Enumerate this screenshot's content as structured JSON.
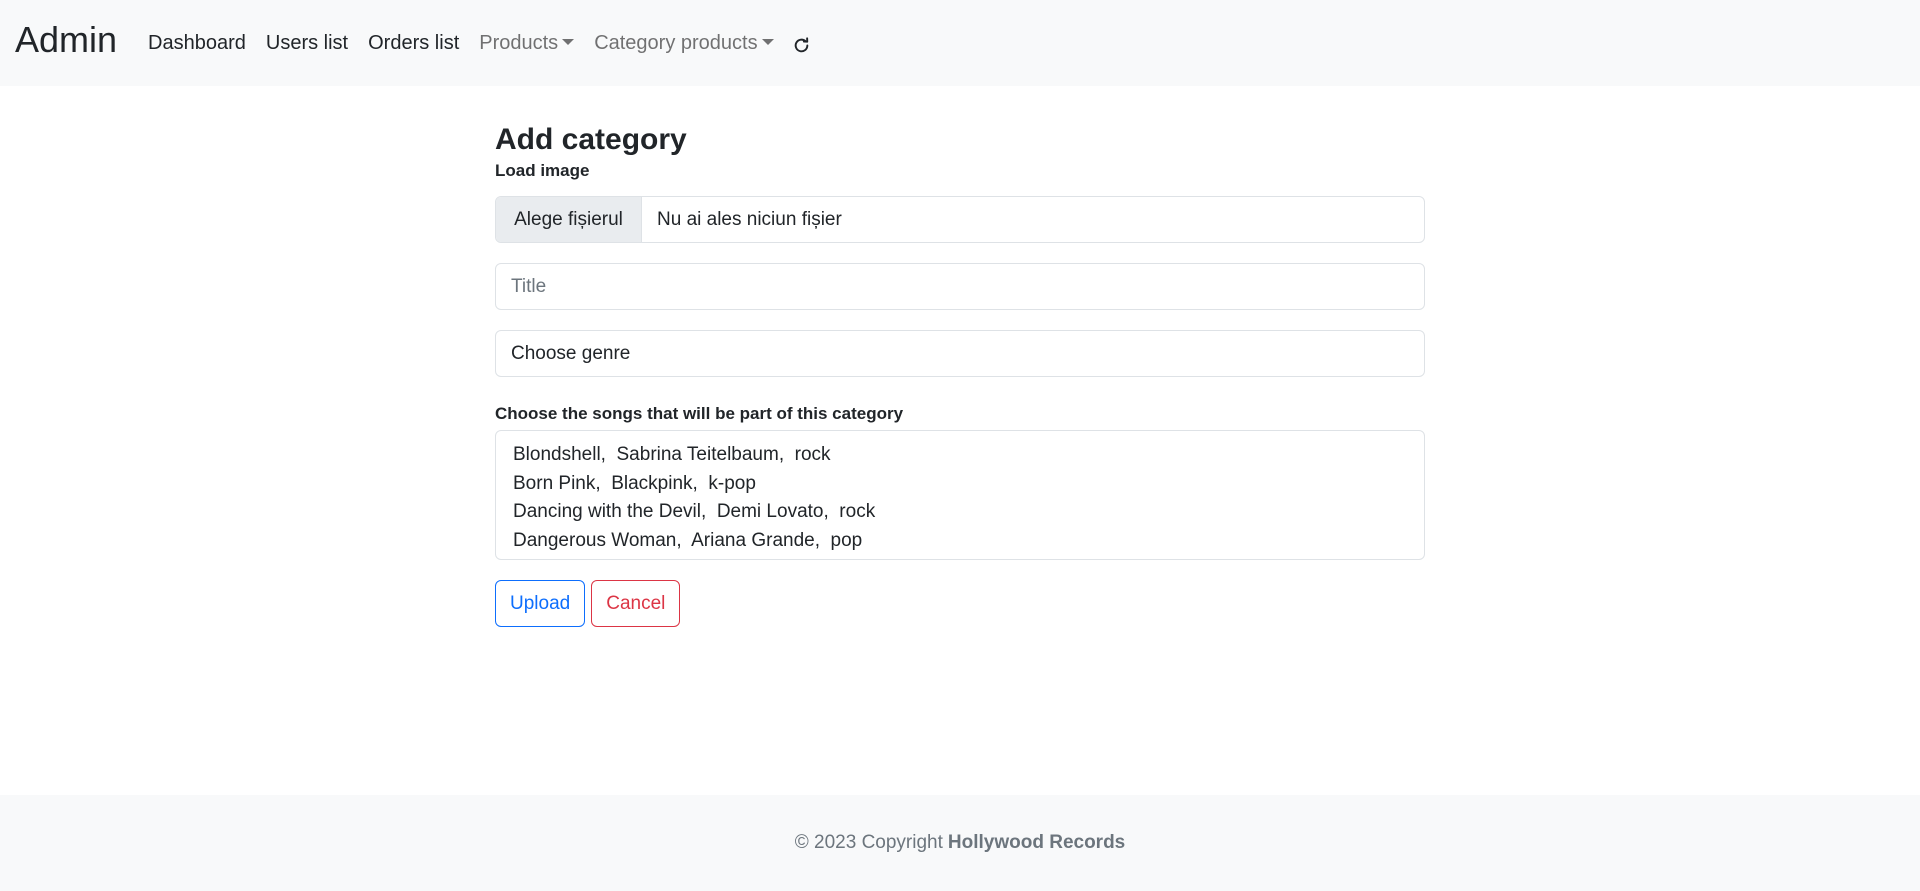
{
  "navbar": {
    "brand": "Admin",
    "links": [
      {
        "label": "Dashboard"
      },
      {
        "label": "Users list"
      },
      {
        "label": "Orders list"
      },
      {
        "label": "Products"
      },
      {
        "label": "Category products"
      }
    ],
    "refresh_icon": "refresh-icon"
  },
  "form": {
    "title": "Add category",
    "image_label": "Load image",
    "file_button": "Alege fișierul",
    "file_status": "Nu ai ales niciun fișier",
    "title_placeholder": "Title",
    "title_value": "",
    "genre_selected": "Choose genre",
    "songs_label": "Choose the songs that will be part of this category",
    "songs": [
      "Blondshell,  Sabrina Teitelbaum,  rock",
      "Born Pink,  Blackpink,  k-pop",
      "Dancing with the Devil,  Demi Lovato,  rock",
      "Dangerous Woman,  Ariana Grande,  pop"
    ],
    "upload_label": "Upload",
    "cancel_label": "Cancel"
  },
  "footer": {
    "text": "© 2023 Copyright",
    "company": "Hollywood Records"
  },
  "colors": {
    "navbar_bg": "#f8f9fa",
    "primary": "#0d6efd",
    "danger": "#dc3545",
    "muted": "#6c757d"
  }
}
